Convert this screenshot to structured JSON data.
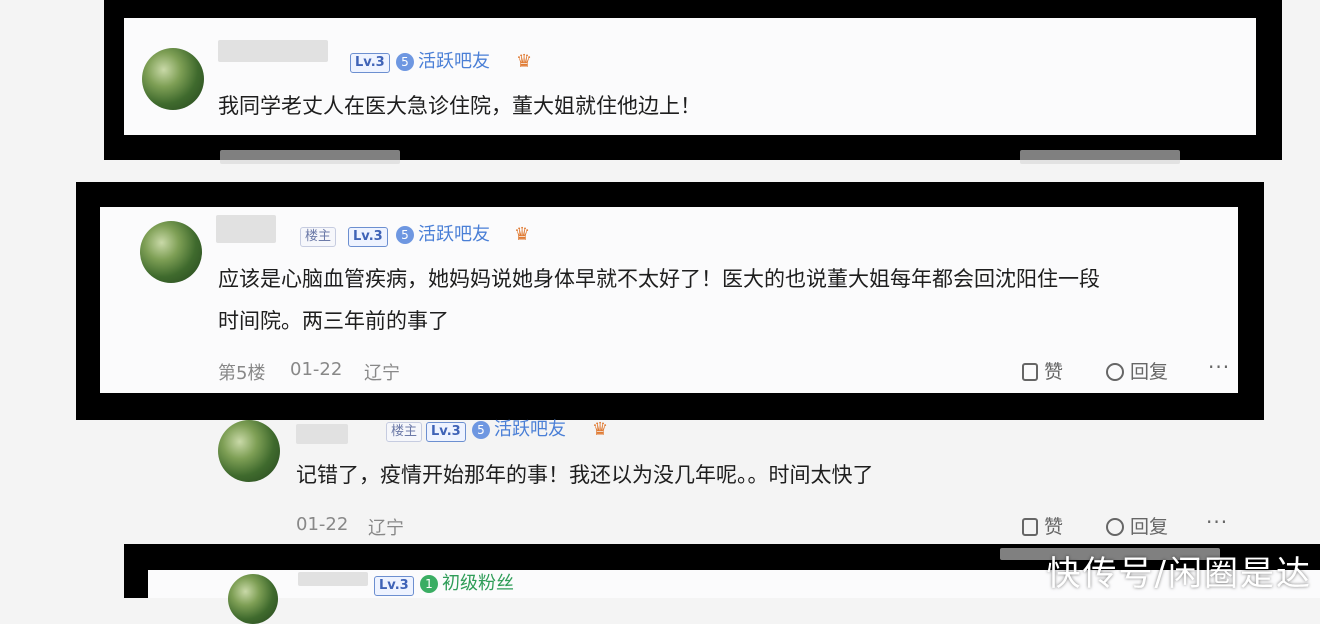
{
  "comments": [
    {
      "level": "Lv.3",
      "tag_num": "5",
      "tag": "活跃吧友",
      "text": "我同学老丈人在医大急诊住院，董大姐就住他边上！"
    },
    {
      "role": "楼主",
      "level": "Lv.3",
      "tag_num": "5",
      "tag": "活跃吧友",
      "text_line1": "应该是心脑血管疾病，她妈妈说她身体早就不太好了！医大的也说董大姐每年都会回沈阳住一段",
      "text_line2": "时间院。两三年前的事了",
      "floor": "第5楼",
      "date": "01-22",
      "location": "辽宁",
      "like": "赞",
      "reply": "回复",
      "more": "···"
    },
    {
      "role": "楼主",
      "level": "Lv.3",
      "tag_num": "5",
      "tag": "活跃吧友",
      "text": "记错了，疫情开始那年的事！我还以为没几年呢。。时间太快了",
      "date": "01-22",
      "location": "辽宁",
      "like": "赞",
      "reply": "回复",
      "more": "···"
    },
    {
      "level": "Lv.3",
      "tag_num": "1",
      "tag": "初级粉丝"
    }
  ],
  "watermark": "快传号/闲圈是达",
  "colors": {
    "frame": "#000000",
    "badge_blue": "#4a7fd6",
    "badge_green": "#2f9d58"
  }
}
